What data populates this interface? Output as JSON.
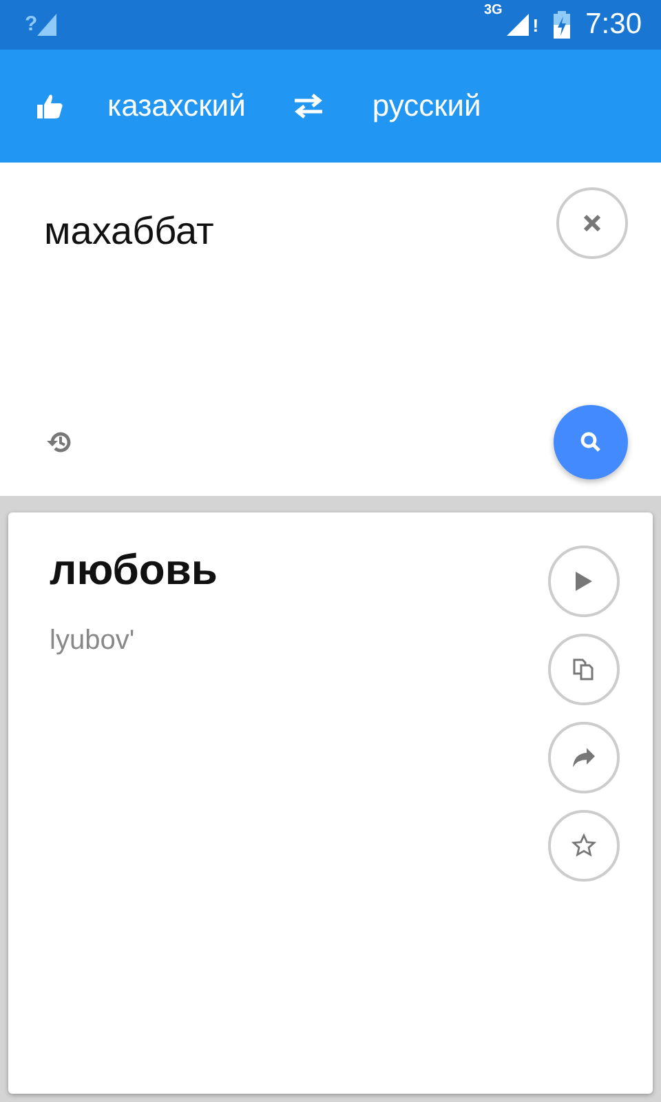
{
  "status_bar": {
    "signal_mark": "?",
    "network": "3G",
    "alert": "!",
    "time": "7:30"
  },
  "toolbar": {
    "source_language": "казахский",
    "target_language": "русский"
  },
  "input": {
    "value": "махаббат"
  },
  "result": {
    "translation": "любовь",
    "transliteration": "lyubov'"
  }
}
